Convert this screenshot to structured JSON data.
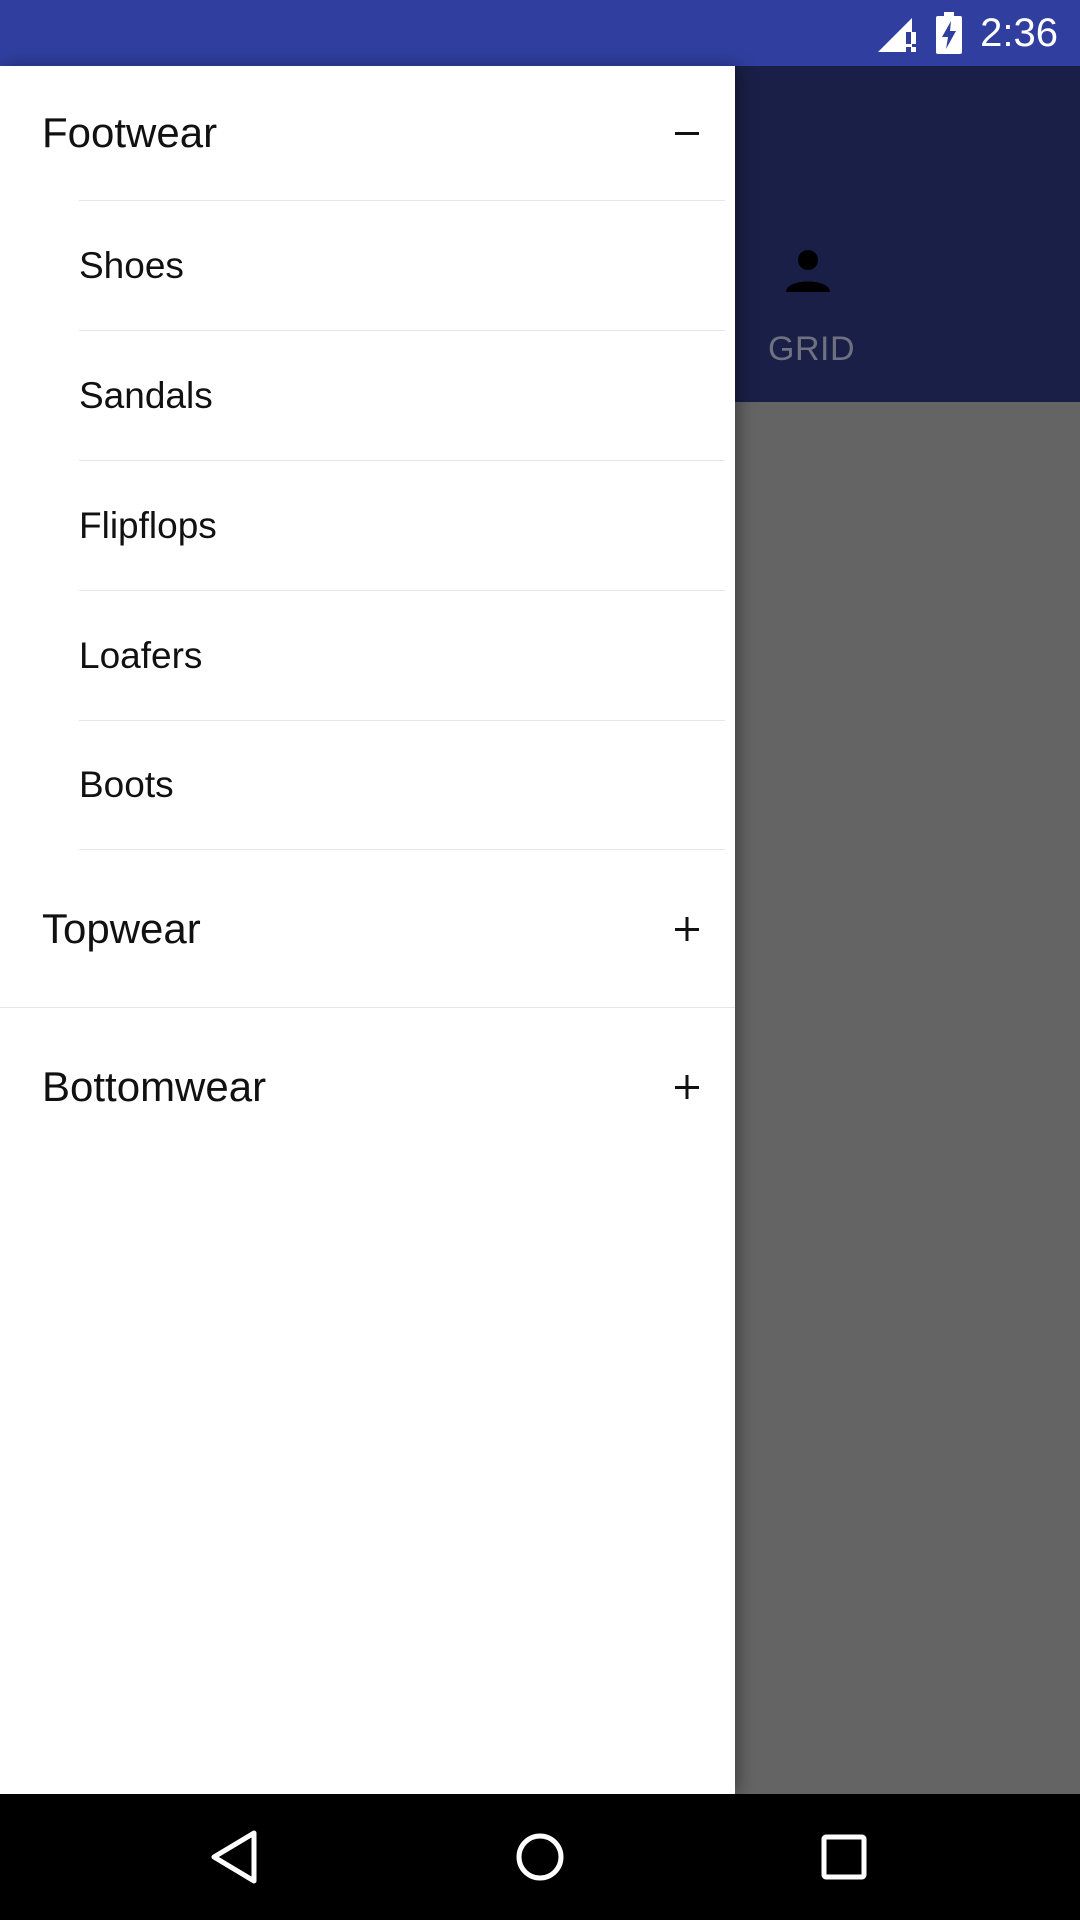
{
  "status_bar": {
    "time": "2:36",
    "background_color": "#303F9F",
    "icons": [
      "signal-no-data-icon",
      "battery-charging-icon"
    ]
  },
  "background_app": {
    "header_color": "#1A1F47",
    "tab": {
      "icon": "person-icon",
      "label": "GRID"
    }
  },
  "drawer": {
    "groups": [
      {
        "label": "Footwear",
        "expanded": true,
        "toggle_icon": "minus-icon",
        "items": [
          "Shoes",
          "Sandals",
          "Flipflops",
          "Loafers",
          "Boots"
        ]
      },
      {
        "label": "Topwear",
        "expanded": false,
        "toggle_icon": "plus-icon"
      },
      {
        "label": "Bottomwear",
        "expanded": false,
        "toggle_icon": "plus-icon"
      }
    ]
  },
  "nav_bar": {
    "icons": [
      "back-icon",
      "home-icon",
      "recents-icon"
    ]
  }
}
